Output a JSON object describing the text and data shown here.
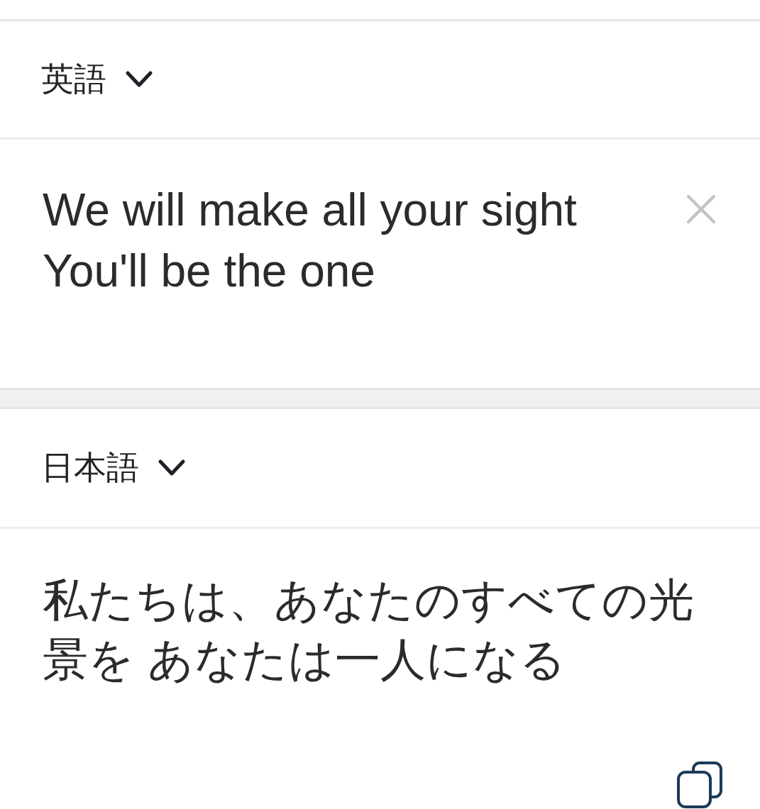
{
  "source": {
    "language": "英語",
    "text": "We will make all your sight\nYou'll be the one"
  },
  "target": {
    "language": "日本語",
    "text": "私たちは、あなたのすべての光景を あなたは一人になる"
  }
}
